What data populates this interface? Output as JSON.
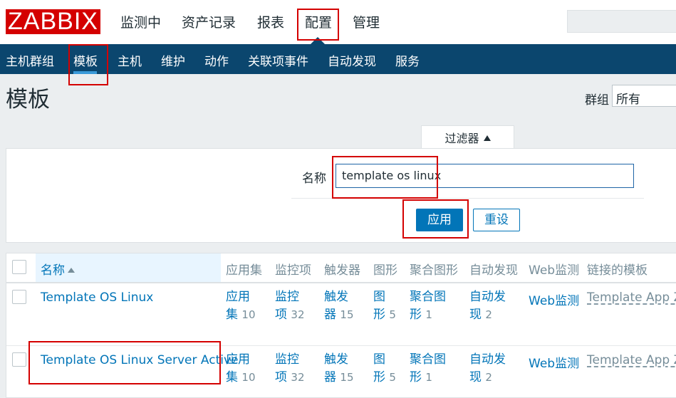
{
  "app": {
    "logo": "ZABBIX"
  },
  "main_menu": [
    "监测中",
    "资产记录",
    "报表",
    "配置",
    "管理"
  ],
  "sub_menu": [
    "主机群组",
    "模板",
    "主机",
    "维护",
    "动作",
    "关联项事件",
    "自动发现",
    "服务"
  ],
  "page": {
    "title": "模板",
    "group_label": "群组",
    "group_value": "所有"
  },
  "filter": {
    "tab_label": "过滤器",
    "name_label": "名称",
    "name_value": "template os linux",
    "apply": "应用",
    "reset": "重设"
  },
  "table": {
    "columns": [
      "名称",
      "应用集",
      "监控项",
      "触发器",
      "图形",
      "聚合图形",
      "自动发现",
      "Web监测",
      "链接的模板"
    ],
    "rows": [
      {
        "name": "Template OS Linux",
        "apps": [
          "应用",
          "集"
        ],
        "apps_count": "10",
        "items": [
          "监控",
          "项"
        ],
        "items_count": "32",
        "triggers": [
          "触发",
          "器"
        ],
        "triggers_count": "15",
        "graphs": [
          "图",
          "形"
        ],
        "graphs_count": "5",
        "screens": [
          "聚合图",
          "形"
        ],
        "screens_count": "1",
        "discovery": [
          "自动发",
          "现"
        ],
        "discovery_count": "2",
        "web": "Web监测",
        "linked": "Template App Za"
      },
      {
        "name": "Template OS Linux Server Active",
        "apps": [
          "应用",
          "集"
        ],
        "apps_count": "10",
        "items": [
          "监控",
          "项"
        ],
        "items_count": "32",
        "triggers": [
          "触发",
          "器"
        ],
        "triggers_count": "15",
        "graphs": [
          "图",
          "形"
        ],
        "graphs_count": "5",
        "screens": [
          "聚合图",
          "形"
        ],
        "screens_count": "1",
        "discovery": [
          "自动发",
          "现"
        ],
        "discovery_count": "2",
        "web": "Web监测",
        "linked": "Template App Za"
      }
    ]
  },
  "colors": {
    "brand": "#d40000",
    "nav": "#0b466e",
    "link": "#0275b8",
    "highlight_box": "#d40000"
  }
}
